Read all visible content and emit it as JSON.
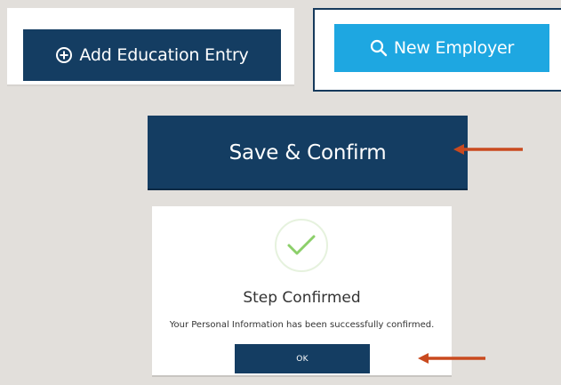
{
  "education_card": {
    "button_label": "Add Education Entry",
    "button_icon": "plus-circle-icon"
  },
  "employer_card": {
    "button_label": "New Employer",
    "button_icon": "search-icon"
  },
  "save_button": {
    "label": "Save & Confirm"
  },
  "dialog": {
    "icon": "checkmark-icon",
    "title": "Step Confirmed",
    "message": "Your Personal Information has been successfully confirmed.",
    "ok_label": "OK"
  },
  "colors": {
    "navy": "#143d62",
    "light_blue": "#1ea7e1",
    "background": "#e2dfdb",
    "arrow_red": "#c94a1f",
    "check_green": "#8ccf6a"
  }
}
